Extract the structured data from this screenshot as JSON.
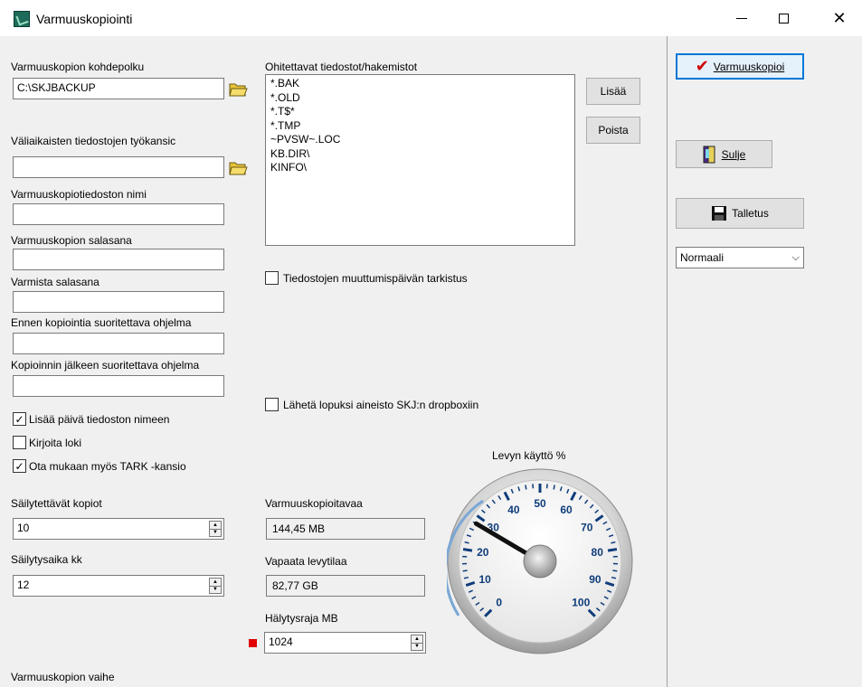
{
  "window": {
    "title": "Varmuuskopiointi"
  },
  "fields": {
    "target_path_label": "Varmuuskopion kohdepolku",
    "target_path_value": "C:\\SKJBACKUP",
    "temp_folder_label": "Väliaikaisten tiedostojen työkansic",
    "temp_folder_value": "",
    "file_name_label": "Varmuuskopiotiedoston nimi",
    "password_label": "Varmuuskopion salasana",
    "confirm_password_label": "Varmista salasana",
    "pre_program_label": "Ennen kopiointia suoritettava ohjelma",
    "post_program_label": "Kopioinnin jälkeen suoritettava ohjelma"
  },
  "checkboxes": [
    {
      "label": "Lisää päivä tiedoston nimeen",
      "checked": true
    },
    {
      "label": "Kirjoita loki",
      "checked": false
    },
    {
      "label": "Ota mukaan myös TARK -kansio",
      "checked": true
    }
  ],
  "retention": {
    "copies_label": "Säilytettävät kopiot",
    "copies_value": "10",
    "months_label": "Säilytysaika kk",
    "months_value": "12"
  },
  "stage_label": "Varmuuskopion vaihe",
  "exclusions": {
    "label": "Ohitettavat tiedostot/hakemistot",
    "items": [
      "*.BAK",
      "*.OLD",
      "*.T$*",
      "*.TMP",
      "~PVSW~.LOC",
      "KB.DIR\\",
      "KINFO\\"
    ],
    "add_label": "Lisää",
    "remove_label": "Poista"
  },
  "options": {
    "modified_date_check": "Tiedostojen muuttumispäivän tarkistus",
    "dropbox_send": "Lähetä lopuksi aineisto SKJ:n dropboxiin"
  },
  "stats": {
    "backup_size_label": "Varmuuskopioitavaa",
    "backup_size_value": "144,45 MB",
    "free_space_label": "Vapaata levytilaa",
    "free_space_value": "82,77 GB",
    "alert_label": "Hälytysraja MB",
    "alert_value": "1024"
  },
  "gauge": {
    "title": "Levyn käyttö %",
    "min": 0,
    "max": 100,
    "value": 28,
    "ticks": [
      "0",
      "10",
      "20",
      "30",
      "40",
      "50",
      "60",
      "70",
      "80",
      "90",
      "100"
    ]
  },
  "actions": {
    "backup_label": "Varmuuskopioi",
    "close_label": "Sulje",
    "save_label": "Talletus",
    "mode_value": "Normaali"
  },
  "colors": {
    "alert_indicator": "#e00000",
    "check_red": "#d00000",
    "gauge_arc": "#7aa7d6"
  }
}
